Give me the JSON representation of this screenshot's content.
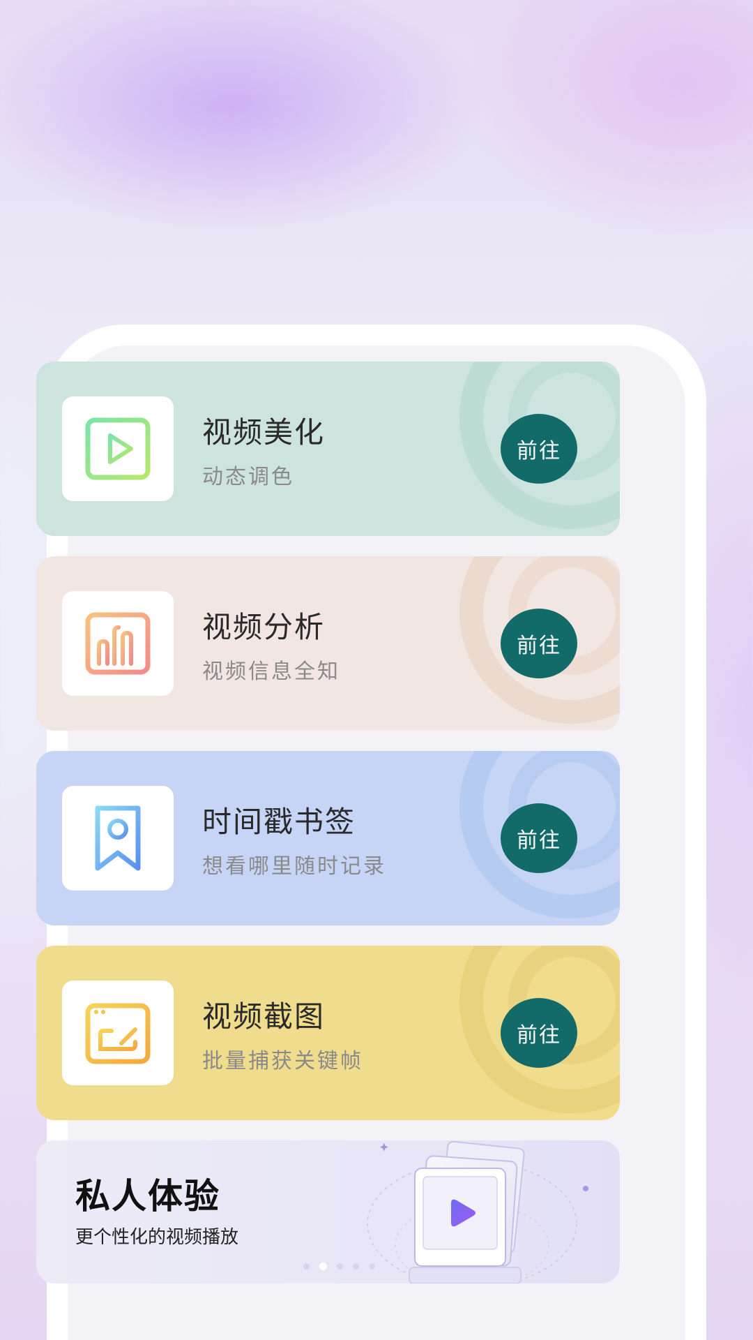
{
  "cards": [
    {
      "title": "视频美化",
      "subtitle": "动态调色",
      "button": "前往",
      "icon": "video-play-icon"
    },
    {
      "title": "视频分析",
      "subtitle": "视频信息全知",
      "button": "前往",
      "icon": "analysis-bars-icon"
    },
    {
      "title": "时间戳书签",
      "subtitle": "想看哪里随时记录",
      "button": "前往",
      "icon": "bookmark-icon"
    },
    {
      "title": "视频截图",
      "subtitle": "批量捕获关键帧",
      "button": "前往",
      "icon": "screenshot-window-icon"
    }
  ],
  "banner": {
    "title": "私人体验",
    "subtitle": "更个性化的视频播放",
    "icon": "video-player-illustration",
    "carousel_pages": 5,
    "carousel_active": 2
  },
  "colors": {
    "button": "#126b68",
    "card1": "#cde3de",
    "card2": "#f2e6e2",
    "card3": "#c6d5f6",
    "card4": "#efdc8c"
  }
}
